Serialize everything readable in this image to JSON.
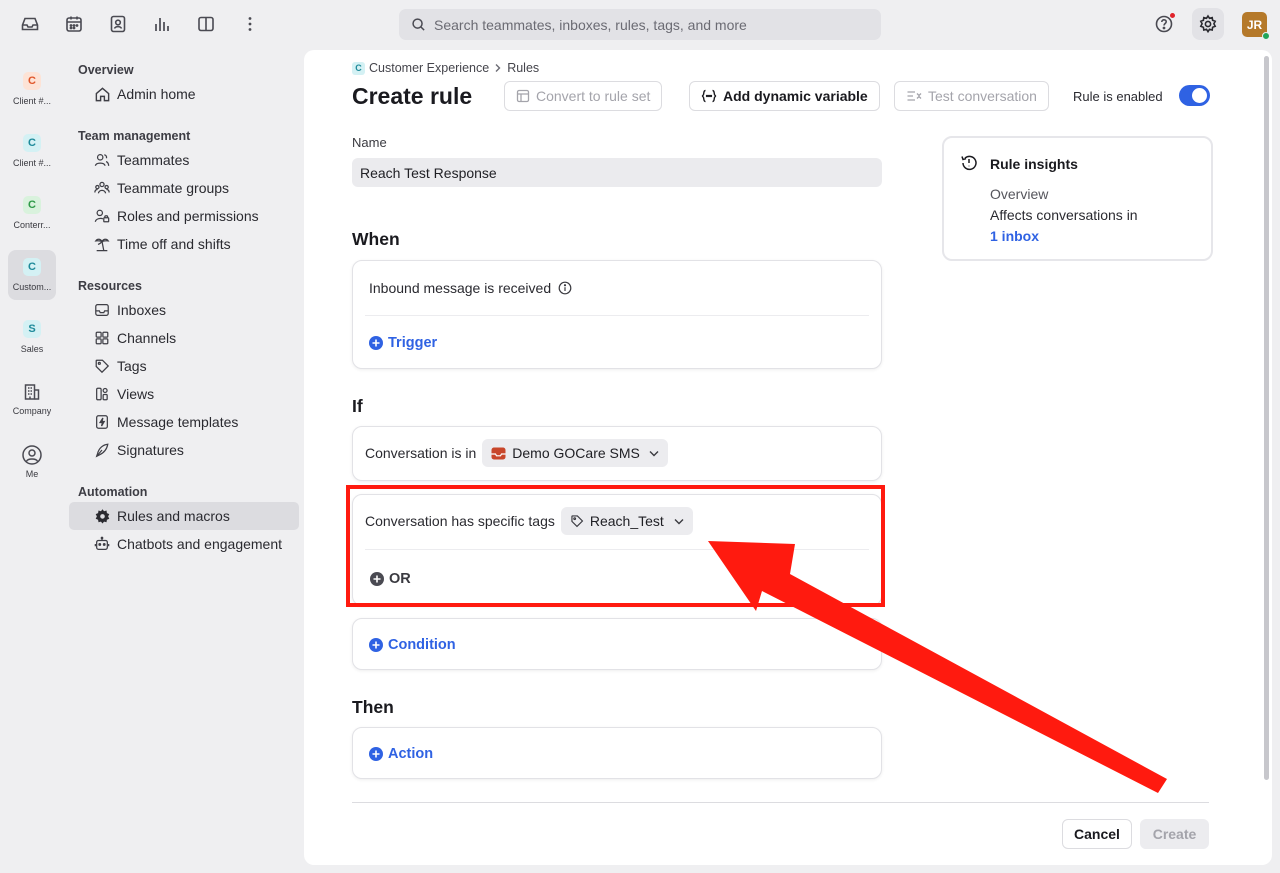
{
  "topbar": {
    "search_placeholder": "Search teammates, inboxes, rules, tags, and more",
    "avatar_initials": "JR",
    "icons": [
      "inbox-icon",
      "calendar-icon",
      "contacts-icon",
      "analytics-icon",
      "split-view-icon",
      "more-icon",
      "help-icon",
      "settings-icon"
    ]
  },
  "rail": {
    "items": [
      {
        "badge": "C",
        "label": "Client #...",
        "badge_bg": "#fde3d6",
        "badge_fg": "#e0562a"
      },
      {
        "badge": "C",
        "label": "Client #...",
        "badge_bg": "#d4f1f4",
        "badge_fg": "#1e8a9a"
      },
      {
        "badge": "C",
        "label": "Conterr...",
        "badge_bg": "#d9f2dd",
        "badge_fg": "#2e9a48"
      },
      {
        "badge": "C",
        "label": "Custom...",
        "badge_bg": "#d4f1f4",
        "badge_fg": "#1e8a9a"
      },
      {
        "badge": "S",
        "label": "Sales",
        "badge_bg": "#d4f1f4",
        "badge_fg": "#1e8a9a"
      },
      {
        "label": "Company"
      },
      {
        "label": "Me"
      }
    ]
  },
  "nav": {
    "overview": {
      "title": "Overview",
      "items": [
        "Admin home"
      ]
    },
    "team": {
      "title": "Team management",
      "items": [
        "Teammates",
        "Teammate groups",
        "Roles and permissions",
        "Time off and shifts"
      ]
    },
    "resources": {
      "title": "Resources",
      "items": [
        "Inboxes",
        "Channels",
        "Tags",
        "Views",
        "Message templates",
        "Signatures"
      ]
    },
    "automation": {
      "title": "Automation",
      "items": [
        "Rules and macros",
        "Chatbots and engagement"
      ]
    }
  },
  "main": {
    "breadcrumb": {
      "badge": "C",
      "parent": "Customer Experience",
      "current": "Rules"
    },
    "title": "Create rule",
    "buttons": {
      "convert": "Convert to rule set",
      "dynamic": "Add dynamic variable",
      "test": "Test conversation"
    },
    "enabled_label": "Rule is enabled",
    "enabled": true,
    "name_label": "Name",
    "name_value": "Reach Test Response",
    "when": {
      "heading": "When",
      "trigger_text": "Inbound message is received",
      "add_trigger": "Trigger"
    },
    "if": {
      "heading": "If",
      "condition1_text": "Conversation is in",
      "condition1_value": "Demo GOCare SMS",
      "condition2_text": "Conversation has specific tags",
      "condition2_value": "Reach_Test",
      "or_label": "OR",
      "add_condition": "Condition"
    },
    "then": {
      "heading": "Then",
      "add_action": "Action"
    },
    "insights": {
      "title": "Rule insights",
      "subtitle": "Overview",
      "text": "Affects conversations in",
      "link": "1 inbox"
    },
    "footer": {
      "cancel": "Cancel",
      "create": "Create"
    }
  },
  "annotation": {
    "color": "#ff1a0f"
  }
}
